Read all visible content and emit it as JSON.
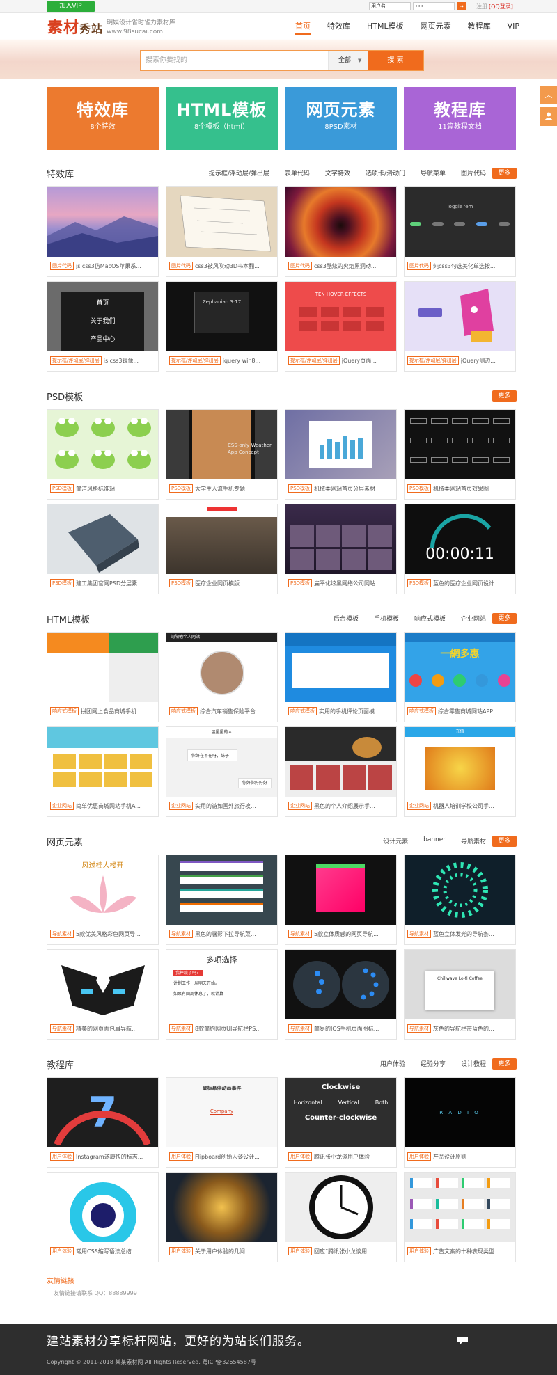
{
  "topbar": {
    "vip": "加入VIP",
    "username": "用户名",
    "password": "•••",
    "go": "➜",
    "register": "注册",
    "qq_login": "[QQ登录]"
  },
  "header": {
    "logo_main": "素材",
    "logo_sub": "秀站",
    "slogan_line1": "明娱设计省时省力素材库",
    "slogan_line2": "www.98sucai.com"
  },
  "nav": [
    "首页",
    "特效库",
    "HTML模板",
    "网页元素",
    "教程库",
    "VIP"
  ],
  "search": {
    "placeholder": "搜索你要找的",
    "scope": "全部",
    "button": "搜 索"
  },
  "colors": {
    "accent": "#f06b1d",
    "vip": "#2cae3a",
    "footer": "#2e2e2e"
  },
  "categories": [
    {
      "title": "特效库",
      "sub": "8个特效",
      "color": "#ec7a2f"
    },
    {
      "title": "HTML模板",
      "sub": "8个模板（html）",
      "color": "#35c08d"
    },
    {
      "title": "网页元素",
      "sub": "8PSD素材",
      "color": "#3a9ad9"
    },
    {
      "title": "教程库",
      "sub": "11篇教程文档",
      "color": "#a965d6"
    }
  ],
  "side_icons": [
    "up-arrow-icon",
    "user-icon"
  ],
  "sections": [
    {
      "title": "特效库",
      "tags": [
        "提示框/浮动层/弹出层",
        "表单代码",
        "文字特效",
        "选项卡/滑动门",
        "导航菜单",
        "图片代码"
      ],
      "more": "更多",
      "items": [
        {
          "badge": "图片代码",
          "title": "js css3仿MacOS苹果系..."
        },
        {
          "badge": "图片代码",
          "title": "css3被风吹动3D书本翻..."
        },
        {
          "badge": "图片代码",
          "title": "css3酷炫的火焰黑洞动..."
        },
        {
          "badge": "图片代码",
          "title": "纯css3勾选美化单选按..."
        },
        {
          "badge": "提示框/浮动层/弹出层",
          "title": "js css3镜像..."
        },
        {
          "badge": "提示框/浮动层/弹出层",
          "title": "jquery win8..."
        },
        {
          "badge": "提示框/浮动层/弹出层",
          "title": "jQuery页面..."
        },
        {
          "badge": "提示框/浮动层/弹出层",
          "title": "jQuery侧边..."
        }
      ]
    },
    {
      "title": "PSD模板",
      "tags": [],
      "more": "更多",
      "items": [
        {
          "badge": "PSD模板",
          "title": "简洁风格标准站"
        },
        {
          "badge": "PSD模板",
          "title": "大学生人流手机专题"
        },
        {
          "badge": "PSD模板",
          "title": "机械类网站首页分层素材"
        },
        {
          "badge": "PSD模板",
          "title": "机械类网站首页效果图"
        },
        {
          "badge": "PSD模板",
          "title": "建工集团官网PSD分层素..."
        },
        {
          "badge": "PSD模板",
          "title": "医疗企业网页模版"
        },
        {
          "badge": "PSD模板",
          "title": "扁平化炫黑网络公司网站..."
        },
        {
          "badge": "PSD模板",
          "title": "蓝色的医疗企业网页设计..."
        }
      ]
    },
    {
      "title": "HTML模板",
      "tags": [
        "后台模板",
        "手机模板",
        "响应式模板",
        "企业网站"
      ],
      "more": "更多",
      "items": [
        {
          "badge": "响应式模板",
          "title": "拼团网上食品商城手机..."
        },
        {
          "badge": "响应式模板",
          "title": "综合汽车销售保险平台..."
        },
        {
          "badge": "响应式模板",
          "title": "实用的手机评论页面模..."
        },
        {
          "badge": "响应式模板",
          "title": "综合零售商城网站APP..."
        },
        {
          "badge": "企业网站",
          "title": "简单优惠商城网站手机A..."
        },
        {
          "badge": "企业网站",
          "title": "实用的游如国外旅行攻..."
        },
        {
          "badge": "企业网站",
          "title": "黑色的个人介绍展示手..."
        },
        {
          "badge": "企业网站",
          "title": "机器人培训学校公司手..."
        }
      ]
    },
    {
      "title": "网页元素",
      "tags": [
        "设计元素",
        "banner",
        "导航素材"
      ],
      "more": "更多",
      "items": [
        {
          "badge": "导航素材",
          "title": "5款优美风格彩色网页导..."
        },
        {
          "badge": "导航素材",
          "title": "黑色的暑影下拉导航菜..."
        },
        {
          "badge": "导航素材",
          "title": "5款立体质感的网页导航..."
        },
        {
          "badge": "导航素材",
          "title": "蓝色立体发光的导航条..."
        },
        {
          "badge": "导航素材",
          "title": "精美的网页面包屑导航..."
        },
        {
          "badge": "导航素材",
          "title": "8款简约网页UI导航栏PS..."
        },
        {
          "badge": "导航素材",
          "title": "简易的IOS手机页面图标..."
        },
        {
          "badge": "导航素材",
          "title": "灰色的导航栏带蓝色的..."
        }
      ]
    },
    {
      "title": "教程库",
      "tags": [
        "用户体验",
        "经验分享",
        "设计教程"
      ],
      "more": "更多",
      "items": [
        {
          "badge": "用户体验",
          "title": "Instagram遂康快的标志..."
        },
        {
          "badge": "用户体验",
          "title": "Flipboard创始人谈设计..."
        },
        {
          "badge": "用户体验",
          "title": "腾讯张小龙谈用户体验"
        },
        {
          "badge": "用户体验",
          "title": "产品设计原则"
        },
        {
          "badge": "用户体验",
          "title": "常用CSS缩写语法总结"
        },
        {
          "badge": "用户体验",
          "title": "关于用户体验的几问"
        },
        {
          "badge": "用户体验",
          "title": "回应“腾讯张小龙谈用..."
        },
        {
          "badge": "用户体验",
          "title": "广告文案的十种表现类型"
        }
      ]
    }
  ],
  "thumb_text": {
    "toggle": "Toggle 'em",
    "menu1": "首页",
    "menu2": "关于我们",
    "menu3": "产品中心",
    "zeph": "Zephaniah 3:17",
    "hover": "TEN HOVER EFFECTS",
    "weather": "CSS-only Weather App Concept",
    "timer": "00:00:11",
    "mobile_site": "阔阳他个人网站",
    "chat_title": "温星星的人",
    "chat_msg1": "你好在不在呀，妹子！",
    "chat_msg2": "你好你好好好",
    "shop_banner": "一網多惠",
    "shop_banner2": "充值",
    "poem": "风过桂人楼开",
    "multi": "多项选择",
    "multi1": "我摔跤了吗？",
    "multi2": "计划工作，从明天开始。",
    "multi3": "如果有四周休息了，就计算",
    "coffee": "Chillwave Lo-fi Coffee",
    "tut_title": "鼠标悬停动画事件",
    "clockwise": "Clockwise",
    "horizontal": "Horizontal",
    "vertical": "Vertical",
    "both": "Both",
    "ccw": "Counter-clockwise",
    "radio": "R A D I O",
    "seven": "7",
    "company": "Company"
  },
  "friend_links": {
    "title": "友情链接",
    "content": "友情链接请联系  QQ：88889999"
  },
  "footer": {
    "slogan": "建站素材分享标杆网站，更好的为站长们服务。",
    "copyright": "Copyright © 2011-2018 某某素材网 All Rights Reserved. 粤ICP备32654587号"
  }
}
